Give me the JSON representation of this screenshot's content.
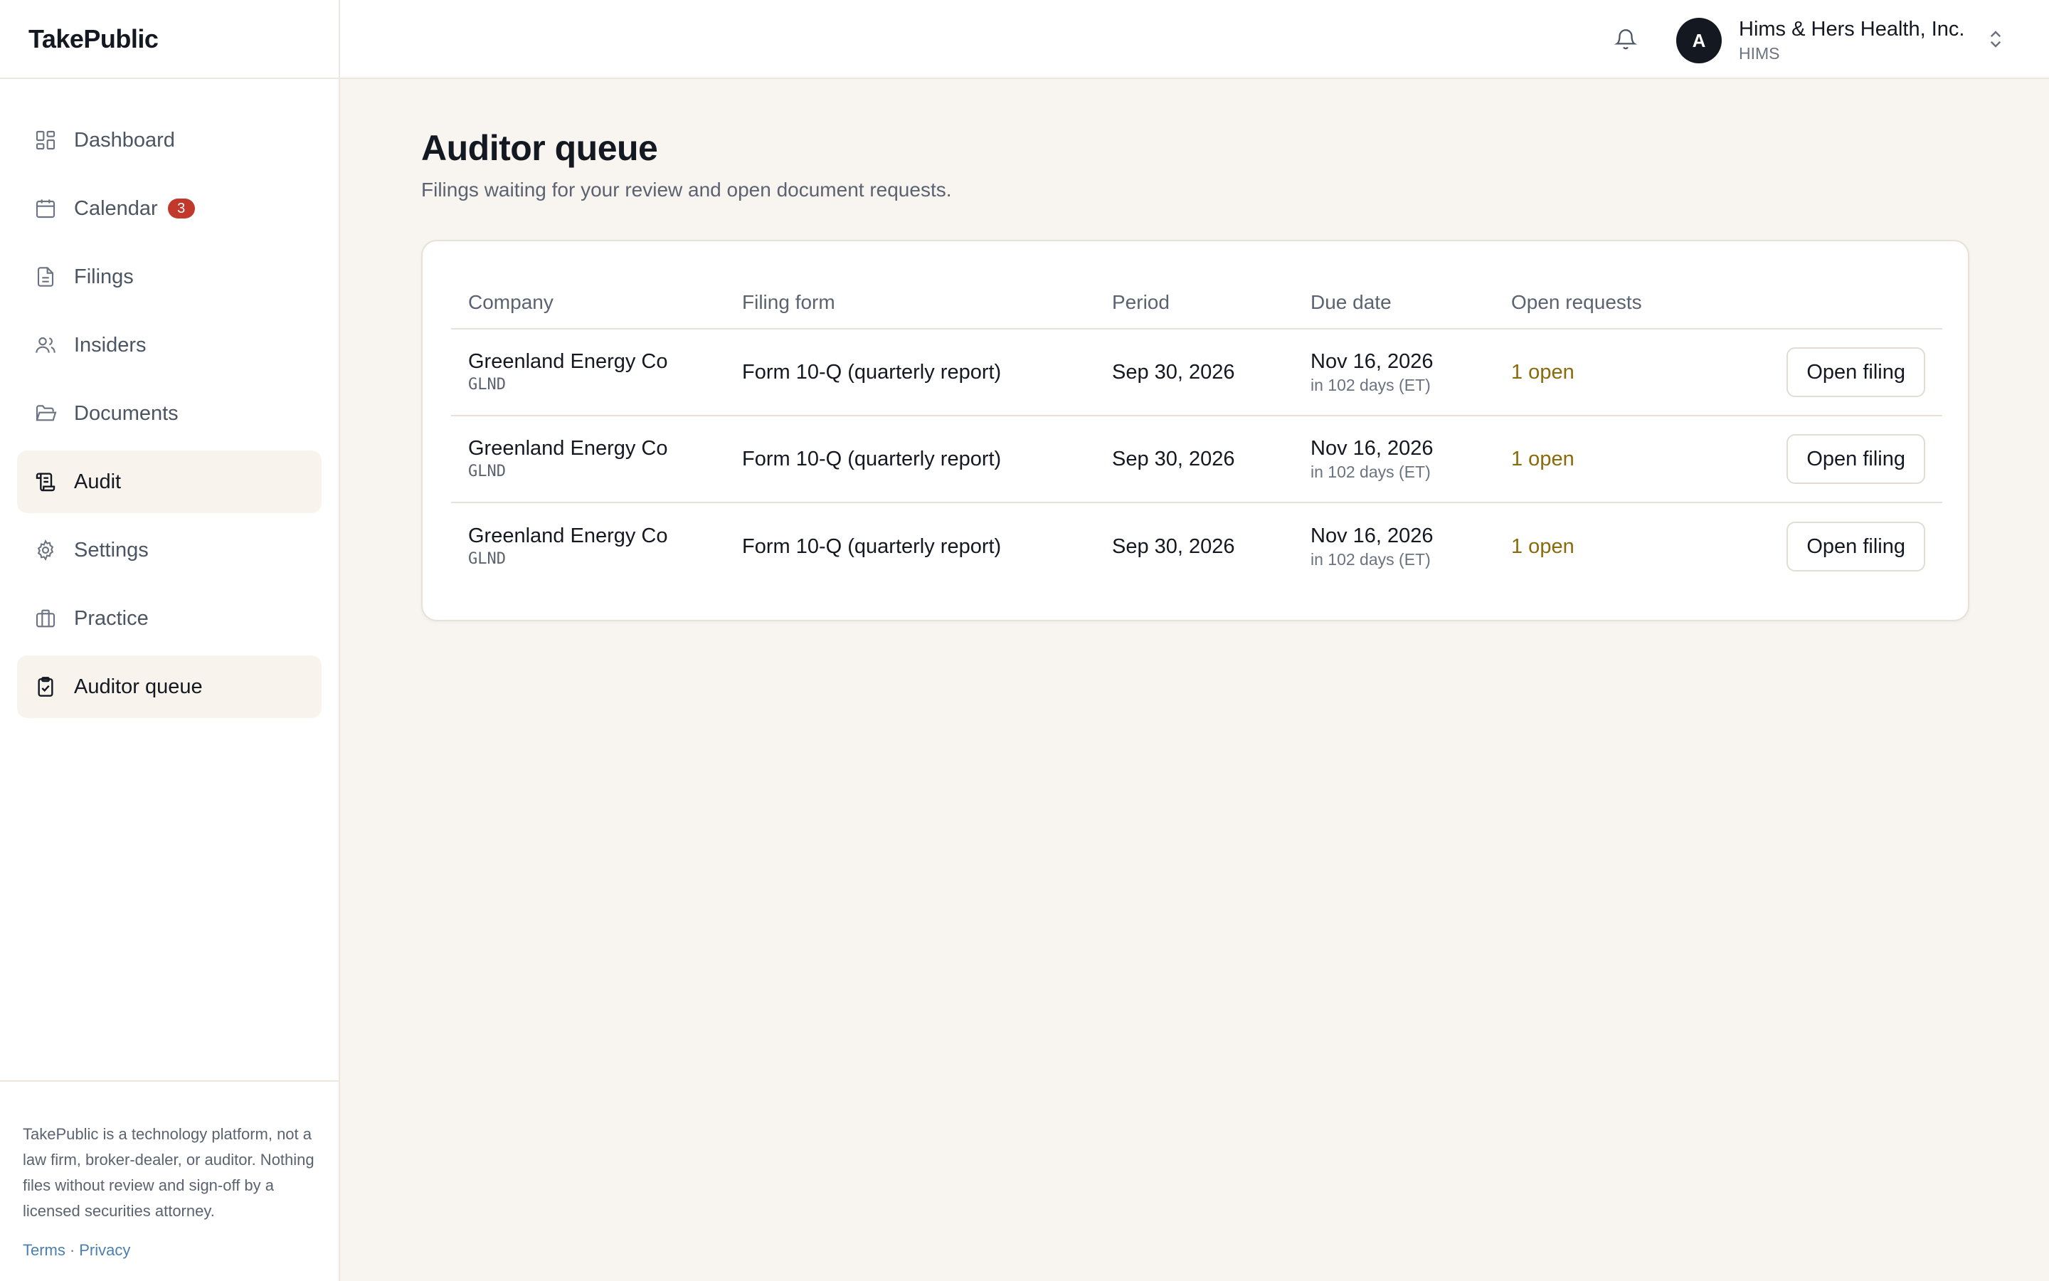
{
  "app": {
    "brand": "TakePublic"
  },
  "sidebar": {
    "items": [
      {
        "label": "Dashboard",
        "icon": "dashboard-icon"
      },
      {
        "label": "Calendar",
        "icon": "calendar-icon",
        "badge": "3"
      },
      {
        "label": "Filings",
        "icon": "file-icon"
      },
      {
        "label": "Insiders",
        "icon": "users-icon"
      },
      {
        "label": "Documents",
        "icon": "folder-icon"
      },
      {
        "label": "Audit",
        "icon": "scroll-icon",
        "active": true
      },
      {
        "label": "Settings",
        "icon": "gear-icon"
      },
      {
        "label": "Practice",
        "icon": "briefcase-icon"
      },
      {
        "label": "Auditor queue",
        "icon": "clipboard-check-icon",
        "active": true
      }
    ],
    "footer": {
      "disclaimer": "TakePublic is a technology platform, not a law firm, broker-dealer, or auditor. Nothing files without review and sign-off by a licensed securities attorney.",
      "terms": "Terms",
      "separator": "·",
      "privacy": "Privacy"
    }
  },
  "topbar": {
    "avatar_initial": "A",
    "company_name": "Hims & Hers Health, Inc.",
    "company_ticker": "HIMS"
  },
  "main": {
    "title": "Auditor queue",
    "subtitle": "Filings waiting for your review and open document requests.",
    "table": {
      "headers": [
        "Company",
        "Filing form",
        "Period",
        "Due date",
        "Open requests",
        ""
      ],
      "rows": [
        {
          "company": "Greenland Energy Co",
          "ticker": "GLND",
          "form": "Form 10-Q (quarterly report)",
          "period": "Sep 30, 2026",
          "due": "Nov 16, 2026",
          "due_relative": "in 102 days (ET)",
          "open_requests": "1 open",
          "action": "Open filing"
        },
        {
          "company": "Greenland Energy Co",
          "ticker": "GLND",
          "form": "Form 10-Q (quarterly report)",
          "period": "Sep 30, 2026",
          "due": "Nov 16, 2026",
          "due_relative": "in 102 days (ET)",
          "open_requests": "1 open",
          "action": "Open filing"
        },
        {
          "company": "Greenland Energy Co",
          "ticker": "GLND",
          "form": "Form 10-Q (quarterly report)",
          "period": "Sep 30, 2026",
          "due": "Nov 16, 2026",
          "due_relative": "in 102 days (ET)",
          "open_requests": "1 open",
          "action": "Open filing"
        }
      ]
    }
  },
  "colors": {
    "accent_dark": "#141821",
    "badge_red": "#c0392b",
    "open_requests": "#8a6a0a",
    "link": "#4a7fb0",
    "page_bg": "#f8f5f0"
  }
}
